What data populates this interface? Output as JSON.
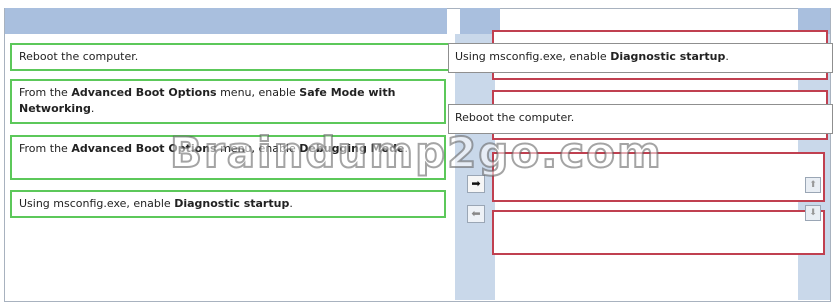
{
  "source_list": [
    {
      "pre": "Reboot the computer.",
      "bold1": "",
      "mid": "",
      "bold2": "",
      "post": ""
    },
    {
      "pre": "From the ",
      "bold1": "Advanced Boot Options",
      "mid": " menu, enable ",
      "bold2": "Safe Mode with Networking",
      "post": "."
    },
    {
      "pre": "From the ",
      "bold1": "Advanced Boot Options",
      "mid": " menu, enable ",
      "bold2": "Debugging Mode",
      "post": "."
    },
    {
      "pre": "Using msconfig.exe, enable ",
      "bold1": "Diagnostic startup",
      "mid": "",
      "bold2": "",
      "post": "."
    }
  ],
  "answer_list": [
    {
      "pre": "Using msconfig.exe, enable ",
      "bold": "Diagnostic startup",
      "post": "."
    },
    {
      "pre": "Reboot the computer.",
      "bold": "",
      "post": ""
    }
  ],
  "controls": {
    "move_right": "➡",
    "move_left": "⬅",
    "move_up": "⬆",
    "move_down": "⬇"
  },
  "watermark": "Braindump2go.com",
  "colors": {
    "source_border": "#5cc85a",
    "slot_border": "#c04050",
    "header": "#a9bfde",
    "lane": "#c9d8ea"
  }
}
